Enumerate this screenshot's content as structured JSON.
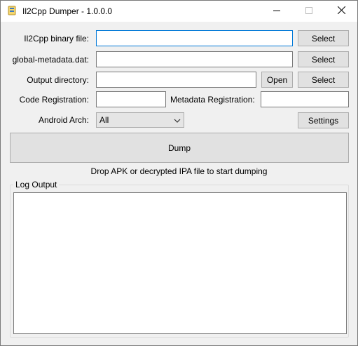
{
  "window": {
    "title": "Il2Cpp Dumper - 1.0.0.0",
    "buttons": {
      "minimize": "minimize-icon",
      "maximize": "maximize-icon",
      "close": "close-icon"
    }
  },
  "form": {
    "binary_label": "Il2Cpp binary file:",
    "binary_value": "",
    "metadata_label": "global-metadata.dat:",
    "metadata_value": "",
    "output_label": "Output directory:",
    "output_value": "",
    "select_label": "Select",
    "open_label": "Open",
    "code_reg_label": "Code Registration:",
    "code_reg_value": "",
    "meta_reg_label": "Metadata Registration:",
    "meta_reg_value": "",
    "arch_label": "Android Arch:",
    "arch_selected": "All",
    "settings_label": "Settings"
  },
  "dump": {
    "button_label": "Dump",
    "hint": "Drop APK or decrypted IPA file to start dumping"
  },
  "log": {
    "title": "Log Output",
    "content": ""
  },
  "colors": {
    "window_bg": "#f0f0f0",
    "focus_border": "#0078d7",
    "button_bg": "#e1e1e1"
  }
}
